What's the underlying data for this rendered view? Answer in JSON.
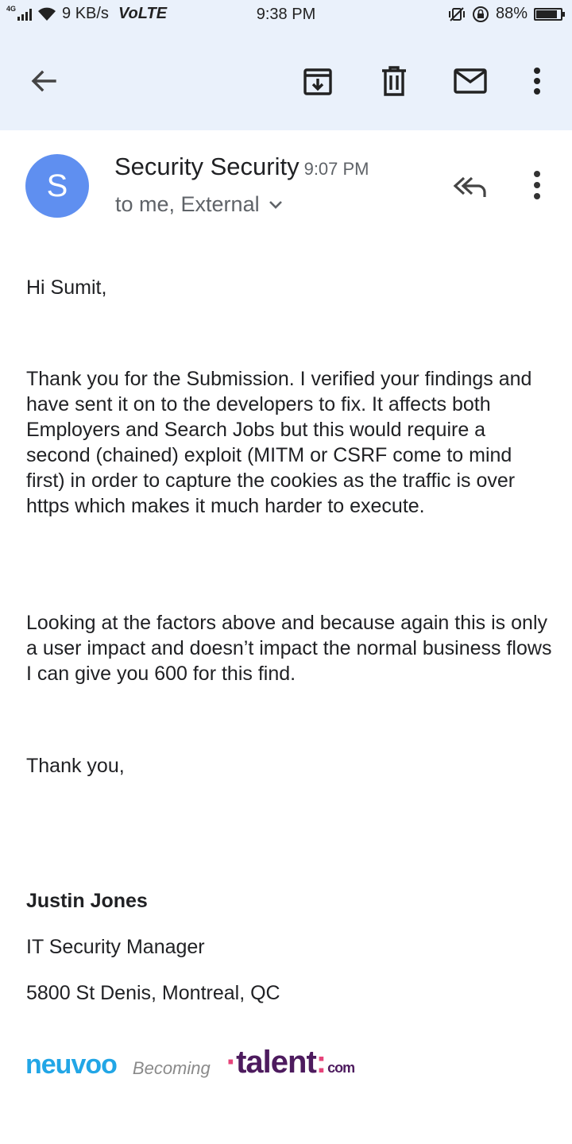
{
  "status_bar": {
    "network": "4G",
    "speed": "9 KB/s",
    "volte": "VoLTE",
    "time": "9:38 PM",
    "battery": "88%",
    "battery_level": 0.88
  },
  "toolbar": {
    "back_icon": "arrow-left-icon",
    "archive_icon": "archive-icon",
    "delete_icon": "trash-icon",
    "mark_unread_icon": "mail-icon",
    "more_icon": "more-vert-icon"
  },
  "message": {
    "avatar_letter": "S",
    "avatar_color": "#5f8ff0",
    "sender": "Security Security",
    "time": "9:07 PM",
    "recipients": "to me, External",
    "greeting": "Hi Sumit,",
    "paragraph1": "Thank you for the Submission. I verified your findings and have sent it on to the developers to fix. It affects both Employers and Search Jobs but this would require a second (chained) exploit  (MITM or CSRF come to mind first) in order to capture the cookies as the traffic is over https which makes it much harder to execute.",
    "paragraph2": "Looking at the factors above and because again this is only a user impact and doesn’t impact the normal business flows I can give you 600 for this find.",
    "closing": "Thank you,",
    "signature": {
      "name": "Justin Jones",
      "title": "IT Security Manager",
      "address": "5800 St Denis, Montreal, QC"
    },
    "logos": {
      "neuvoo": "neuvoo",
      "becoming": "Becoming",
      "talent": "talent",
      "talent_com": "com"
    }
  }
}
